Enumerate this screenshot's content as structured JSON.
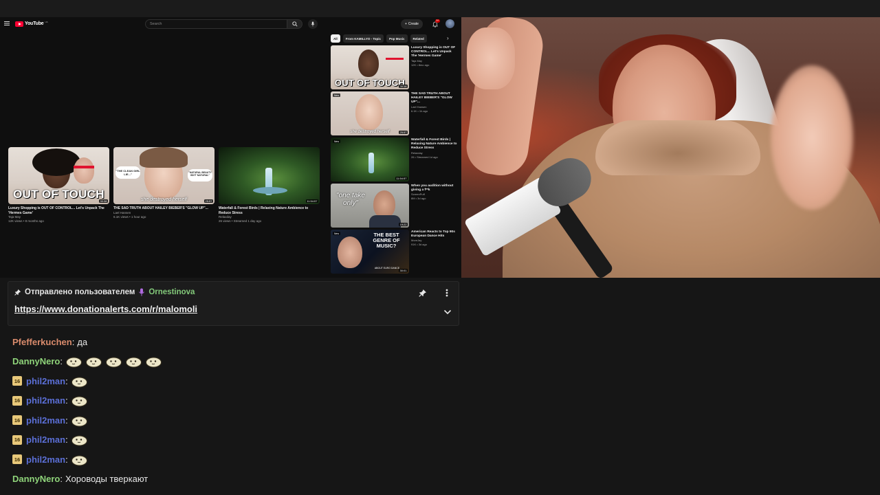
{
  "youtube": {
    "logo_text": "YouTube",
    "logo_region": "UA",
    "search_placeholder": "Search",
    "create_label": "Create",
    "notifications_count": "9+",
    "chips": [
      "All",
      "From KAMILLYO - Topic",
      "Pop Music",
      "Related"
    ],
    "grid": [
      {
        "title": "Luxury Shopping is OUT OF CONTROL... Let's Unpack The 'Hermes Game'",
        "channel": "Taja May",
        "meta": "12K views • 8 months ago",
        "duration": "30:38",
        "caption": "OUT OF TOUCH"
      },
      {
        "title": "THE SAD TRUTH ABOUT HAILEY BIEBER'S \"GLOW UP\"...",
        "channel": "Lael Hansen",
        "meta": "6.1K views • 1 hour ago",
        "duration": "25:57",
        "caption": "she destroyed herself",
        "bubble_a": "\"THE CLEAN GIRL LIE...\"",
        "bubble_b": "\"NATURAL BEAUTY ISN'T NATURAL\""
      },
      {
        "title": "Waterfall & Forest Birds | Relaxing Nature Ambience to Reduce Stress",
        "channel": "Relaxday",
        "meta": "26 views • Streamed 1 day ago",
        "duration": "11:54:57"
      }
    ],
    "sidebar": [
      {
        "title": "Luxury Shopping is OUT OF CONTROL... Let's Unpack The 'Hermes Game'",
        "channel": "Taja May",
        "meta": "12K • 8mo ago",
        "duration": "30:38",
        "caption": "OUT OF TOUCH"
      },
      {
        "title": "THE SAD TRUTH ABOUT HAILEY BIEBER'S \"GLOW UP\"...",
        "channel": "Lael Hansen",
        "meta": "6.1K • 1h ago",
        "duration": "25:57",
        "badge": "New",
        "caption": "she destroyed herself"
      },
      {
        "title": "Waterfall & Forest Birds | Relaxing Nature Ambience to Reduce Stress",
        "channel": "Relaxday",
        "meta": "26 • Streamed 1d ago",
        "duration": "11:54:57",
        "badge": "New"
      },
      {
        "title": "When you audition without giving a f**k",
        "channel": "ScreenPuff",
        "meta": "8M • 3d ago",
        "duration": "19:22",
        "caption": "\"one take only\""
      },
      {
        "title": "American Reacts to Top 90s European Dance Hits",
        "channel": "MoreJay",
        "meta": "91K • 3d ago",
        "duration": "30:01",
        "badge": "New",
        "caption": "THE BEST GENRE OF MUSIC?",
        "mini_caption": "ABOUT EURO DANCE"
      }
    ]
  },
  "pinned": {
    "prefix": "Отправлено пользователем",
    "user": "Ornestinova",
    "link": "https://www.donationalerts.com/r/malomoli"
  },
  "chat": [
    {
      "user": "Pfefferkuchen",
      "color": "#d98b6c",
      "text": "да"
    },
    {
      "user": "DannyNero",
      "color": "#8fd47a",
      "emotes": 5
    },
    {
      "user": "phil2man",
      "color": "#5b6fd6",
      "badge": "16",
      "emotes": 1
    },
    {
      "user": "phil2man",
      "color": "#5b6fd6",
      "badge": "16",
      "emotes": 1
    },
    {
      "user": "phil2man",
      "color": "#5b6fd6",
      "badge": "16",
      "emotes": 1
    },
    {
      "user": "phil2man",
      "color": "#5b6fd6",
      "badge": "16",
      "emotes": 1
    },
    {
      "user": "phil2man",
      "color": "#5b6fd6",
      "badge": "16",
      "emotes": 1
    },
    {
      "user": "DannyNero",
      "color": "#8fd47a",
      "text": "Хороводы тверкают"
    }
  ],
  "colors": {
    "background": "#161616",
    "youtube_red": "#ff0033",
    "pinned_user": "#83c97a",
    "sub_badge": "#e8c87a"
  },
  "icons": {
    "menu": "menu-icon",
    "search": "search-icon",
    "mic": "microphone-icon",
    "bell": "bell-icon",
    "pin": "pin-icon",
    "more": "more-vertical-icon",
    "expand": "chevron-down-icon",
    "emote": "potato-emote-icon"
  }
}
